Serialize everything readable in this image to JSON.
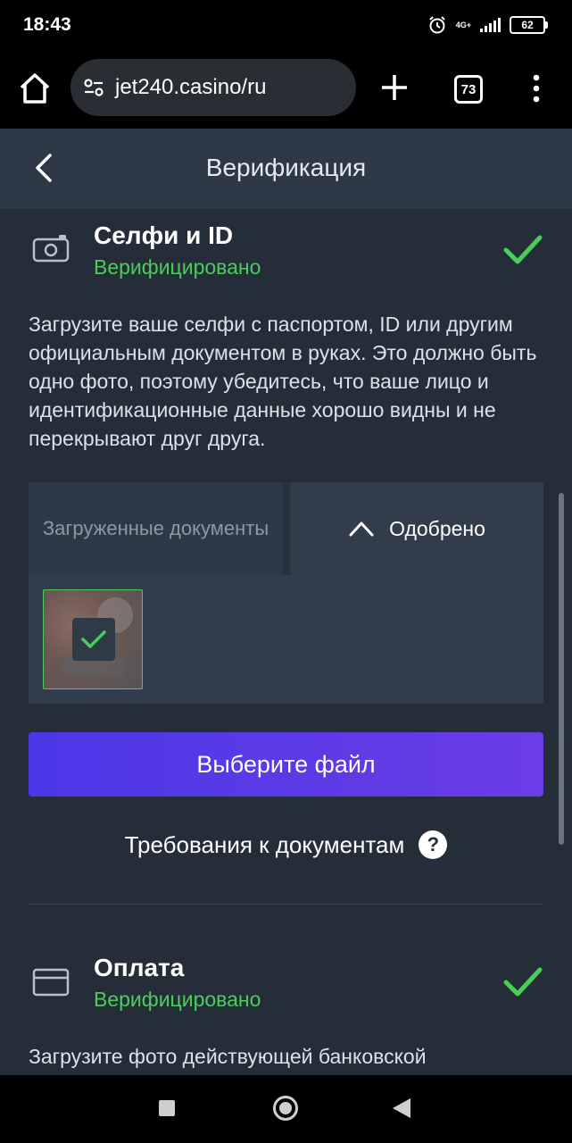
{
  "status_bar": {
    "time": "18:43",
    "network": "4G+",
    "battery": "62"
  },
  "browser": {
    "url": "jet240.casino/ru",
    "tab_count": "73"
  },
  "header": {
    "title": "Верификация"
  },
  "sections": [
    {
      "title": "Селфи и ID",
      "status": "Верифицировано",
      "description": "Загрузите ваше селфи с паспортом, ID или другим официальным документом в руках. Это должно быть одно фото, поэтому убедитесь, что ваше лицо и идентификационные данные хорошо видны и не перекрывают друг друга.",
      "tabs": {
        "uploaded": "Загруженные документы",
        "approved": "Одобрено"
      },
      "choose_file": "Выберите файл",
      "requirements": "Требования к документам",
      "help": "?"
    },
    {
      "title": "Оплата",
      "status": "Верифицировано",
      "description": "Загрузите фото действующей банковской"
    }
  ],
  "colors": {
    "accent_green": "#4ccd5b",
    "button_start": "#4b37e7",
    "button_end": "#6b3de6",
    "background": "#242d38"
  }
}
